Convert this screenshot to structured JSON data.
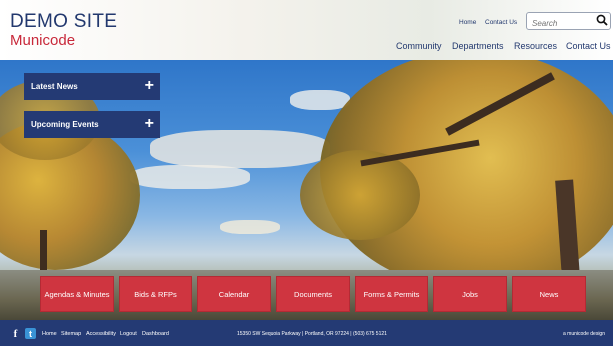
{
  "header": {
    "logo_line1": "DEMO SITE",
    "logo_line2": "Municode",
    "utility": {
      "home": "Home",
      "contact": "Contact Us"
    },
    "search": {
      "placeholder": "Search"
    },
    "nav": [
      "Community",
      "Departments",
      "Resources",
      "Contact Us"
    ]
  },
  "panels": {
    "latest_news": "Latest News",
    "upcoming_events": "Upcoming Events",
    "expand_symbol": "+"
  },
  "quick_links": [
    "Agendas & Minutes",
    "Bids & RFPs",
    "Calendar",
    "Documents",
    "Forms & Permits",
    "Jobs",
    "News"
  ],
  "footer": {
    "social": {
      "facebook": "f",
      "twitter": "t"
    },
    "links": [
      "Home",
      "Sitemap",
      "Accessibility",
      "Logout",
      "Dashboard"
    ],
    "address": "15350 SW Sequoia Parkway | Portland, OR 97224 | (503) 675 5121",
    "design": "a municode design"
  },
  "colors": {
    "brand_navy": "#243a74",
    "brand_red": "#cf3540",
    "logo_red": "#c8283a"
  }
}
